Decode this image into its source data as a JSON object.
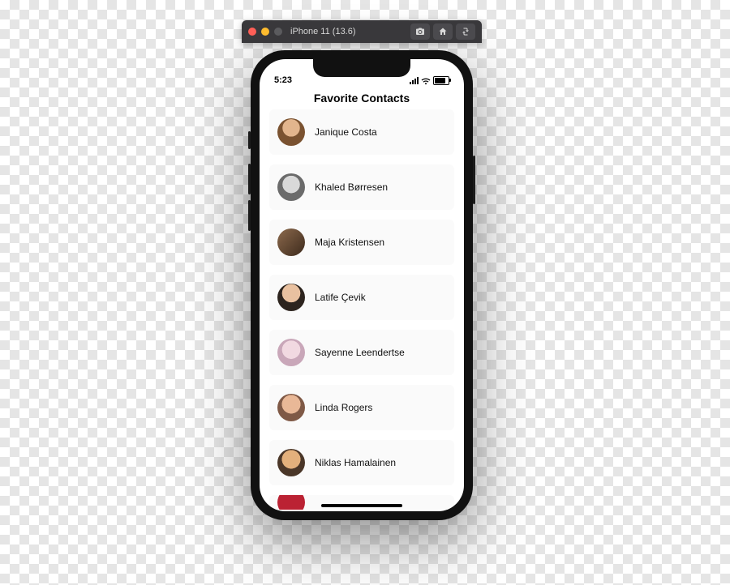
{
  "simulator": {
    "title": "iPhone 11 (13.6)",
    "traffic": {
      "close": "#ff5f57",
      "min": "#febc2e",
      "max": "#5b5b5e"
    },
    "buttons": {
      "screenshot": "screenshot-icon",
      "home": "home-icon",
      "rotate": "rotate-icon"
    }
  },
  "statusbar": {
    "time": "5:23",
    "battery_level": 0.7
  },
  "app": {
    "title": "Favorite Contacts",
    "contacts": [
      {
        "name": "Janique Costa"
      },
      {
        "name": "Khaled Børresen"
      },
      {
        "name": "Maja Kristensen"
      },
      {
        "name": "Latife Çevik"
      },
      {
        "name": "Sayenne Leendertse"
      },
      {
        "name": "Linda Rogers"
      },
      {
        "name": "Niklas Hamalainen"
      }
    ]
  }
}
